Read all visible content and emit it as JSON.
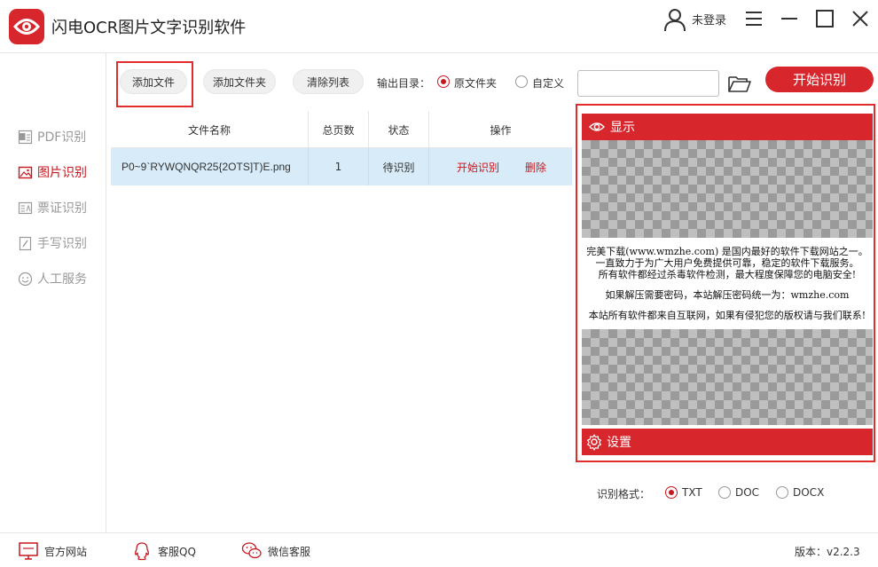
{
  "app": {
    "title": "闪电OCR图片文字识别软件",
    "login": "未登录"
  },
  "sidebar": {
    "items": [
      {
        "label": "PDF识别",
        "icon": "pdf-icon",
        "active": false
      },
      {
        "label": "图片识别",
        "icon": "image-icon",
        "active": true
      },
      {
        "label": "票证识别",
        "icon": "id-card-icon",
        "active": false
      },
      {
        "label": "手写识别",
        "icon": "handwriting-icon",
        "active": false
      },
      {
        "label": "人工服务",
        "icon": "smile-icon",
        "active": false
      }
    ]
  },
  "toolbar": {
    "add_file": "添加文件",
    "add_folder": "添加文件夹",
    "clear_list": "清除列表",
    "output_label": "输出目录：",
    "option_original": "原文件夹",
    "option_custom": "自定义",
    "output_selected": "原文件夹",
    "path_value": "",
    "start": "开始识别"
  },
  "table": {
    "columns": [
      "文件名称",
      "总页数",
      "状态",
      "操作"
    ],
    "rows": [
      {
        "file": "P0~9`RYWQNQR25{2OTS]T)E.png",
        "pages": "1",
        "status": "待识别",
        "op_start": "开始识别",
        "op_delete": "删除"
      }
    ]
  },
  "preview": {
    "header": "显示",
    "lines": [
      "完美下载(www.wmzhe.com) 是国内最好的软件下载网站之一。",
      "一直致力于为广大用户免费提供可靠，稳定的软件下载服务。",
      "所有软件都经过杀毒软件检测，最大程度保障您的电脑安全!",
      "如果解压需要密码，本站解压密码统一为：wmzhe.com",
      "本站所有软件都来自互联网，如果有侵犯您的版权请与我们联系!"
    ],
    "settings": "设置"
  },
  "format": {
    "label": "识别格式：",
    "options": [
      "TXT",
      "DOC",
      "DOCX"
    ],
    "selected": "TXT"
  },
  "footer": {
    "website": "官方网站",
    "qq": "客服QQ",
    "wechat": "微信客服",
    "version": "版本：v2.2.3"
  },
  "colors": {
    "accent": "#d7262c",
    "highlight": "#e22b2b",
    "row_selected": "#d7ecf8",
    "inactive": "#999999"
  }
}
